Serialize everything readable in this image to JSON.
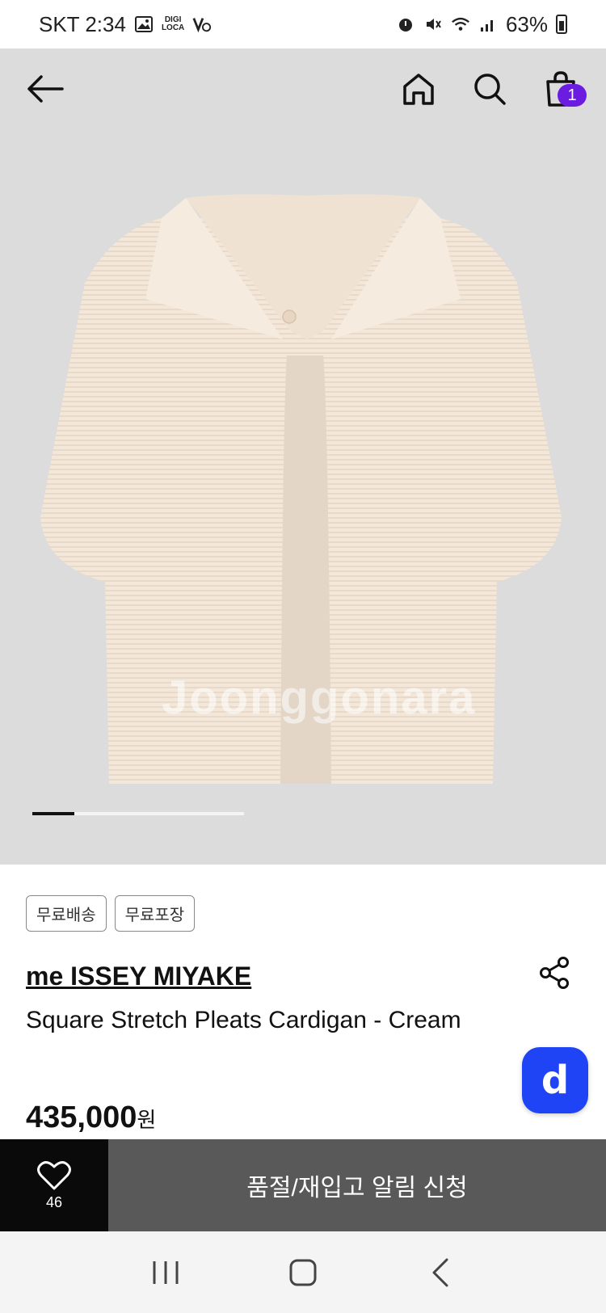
{
  "status_bar": {
    "carrier_time": "SKT 2:34",
    "digi_top": "DIGI",
    "digi_bottom": "LOCA",
    "battery": "63%"
  },
  "nav": {
    "back_icon": "arrow-left-icon",
    "home_icon": "home-icon",
    "search_icon": "search-icon",
    "cart_icon": "shopping-bag-icon",
    "cart_count": "1"
  },
  "gallery": {
    "watermark": "Joonggonara",
    "active_index": 1,
    "total": 5
  },
  "product": {
    "tags": [
      "무료배송",
      "무료포장"
    ],
    "brand": "me ISSEY MIYAKE",
    "title": "Square Stretch Pleats Cardigan - Cream",
    "price": "435,000",
    "price_unit": "원"
  },
  "floating_button": {
    "label": "d"
  },
  "actions": {
    "like_count": "46",
    "notify_label": "품절/재입고 알림 신청"
  },
  "colors": {
    "accent": "#6c1be0",
    "floating": "#1f44f5",
    "like_bg": "#0a0a0a",
    "notify_bg": "#595959"
  }
}
